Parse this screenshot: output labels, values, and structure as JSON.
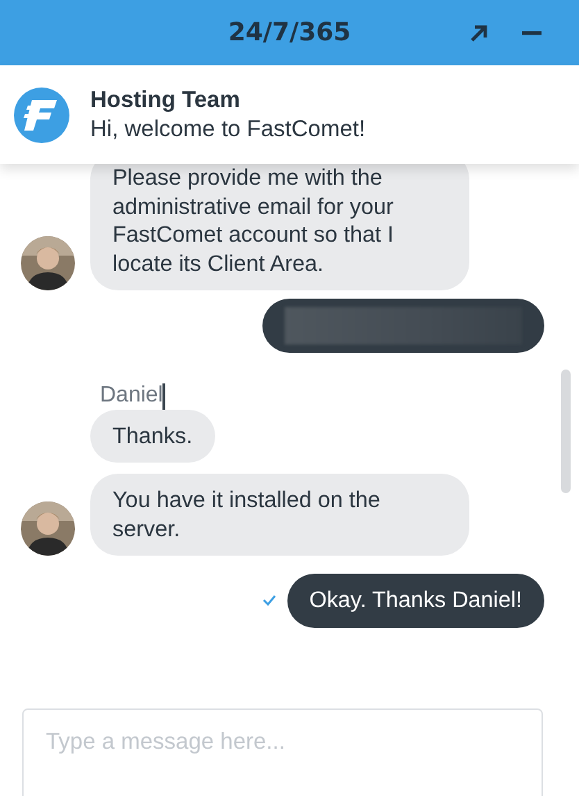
{
  "header": {
    "title": "24/7/365"
  },
  "team": {
    "name": "Hosting Team",
    "greeting": "Hi, welcome to FastComet!"
  },
  "messages": [
    {
      "kind": "agent",
      "avatar": true,
      "text": "Please provide me with the administrative email for your FastComet account so that I locate its Client Area."
    },
    {
      "kind": "redacted"
    },
    {
      "kind": "name",
      "text": "Daniel"
    },
    {
      "kind": "agent",
      "avatar": false,
      "text": "Thanks."
    },
    {
      "kind": "agent",
      "avatar": true,
      "text": "You have it installed on the server."
    },
    {
      "kind": "visitor",
      "read": true,
      "text": "Okay. Thanks Daniel!"
    }
  ],
  "composer": {
    "placeholder": "Type a message here..."
  }
}
